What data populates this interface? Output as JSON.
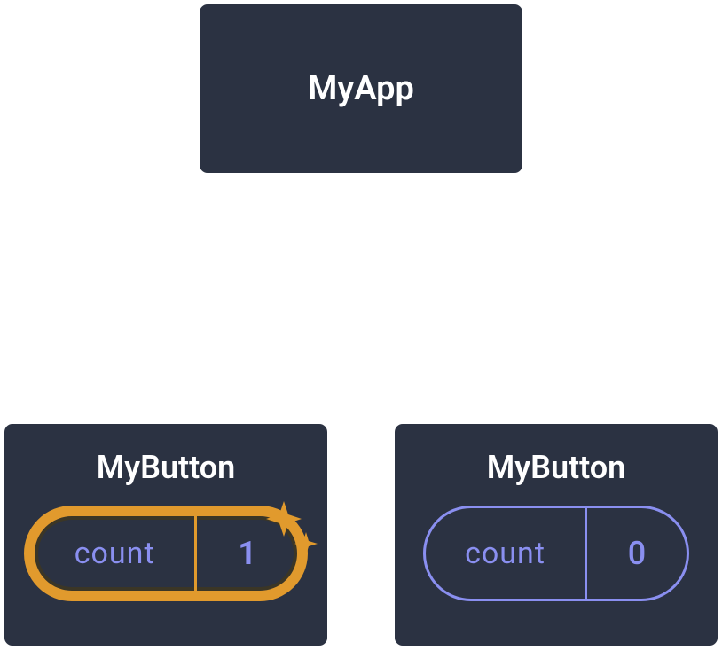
{
  "diagram": {
    "root": {
      "label": "MyApp"
    },
    "children": [
      {
        "label": "MyButton",
        "highlighted": true,
        "state": {
          "key": "count",
          "value": "1"
        }
      },
      {
        "label": "MyButton",
        "highlighted": false,
        "state": {
          "key": "count",
          "value": "0"
        }
      }
    ]
  },
  "colors": {
    "node_bg": "#2b3242",
    "node_border": "#ffffff",
    "connector": "#ffffff",
    "pill_plain_border": "#8a8ff0",
    "pill_highlight_border": "#e19a2d",
    "text_state": "#8a8ff0",
    "sparkle": "#e19a2d"
  }
}
